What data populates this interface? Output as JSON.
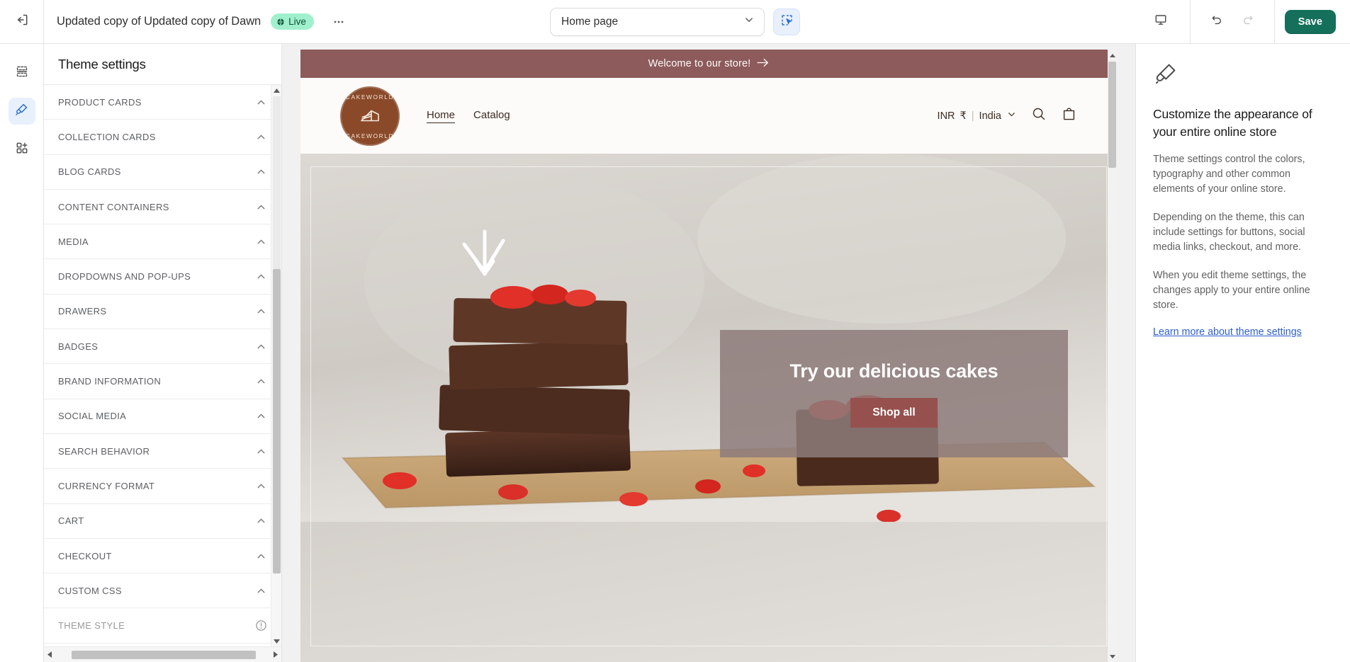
{
  "topbar": {
    "exit_icon": "exit-icon",
    "theme_title": "Updated copy of Updated copy of Dawn",
    "live_badge": "Live",
    "live_icon": "globe-icon",
    "more_icon": "ellipsis-icon",
    "page_selector": {
      "value": "Home page",
      "chevron_icon": "chevron-down-icon"
    },
    "inspect_icon": "inspector-select-icon",
    "device_icon": "desktop-icon",
    "undo_icon": "undo-icon",
    "redo_icon": "redo-icon",
    "save_label": "Save",
    "save_color": "#14705a"
  },
  "rail": {
    "items": [
      {
        "name": "sections-icon",
        "label": "Sections",
        "active": false
      },
      {
        "name": "paintbrush-icon",
        "label": "Theme settings",
        "active": true
      },
      {
        "name": "apps-add-icon",
        "label": "Apps",
        "active": false
      }
    ]
  },
  "settings": {
    "heading": "Theme settings",
    "rows": [
      {
        "label": "PRODUCT CARDS",
        "trailing": "chevron-up-icon",
        "muted": false
      },
      {
        "label": "COLLECTION CARDS",
        "trailing": "chevron-up-icon",
        "muted": false
      },
      {
        "label": "BLOG CARDS",
        "trailing": "chevron-up-icon",
        "muted": false
      },
      {
        "label": "CONTENT CONTAINERS",
        "trailing": "chevron-up-icon",
        "muted": false
      },
      {
        "label": "MEDIA",
        "trailing": "chevron-up-icon",
        "muted": false
      },
      {
        "label": "DROPDOWNS AND POP-UPS",
        "trailing": "chevron-up-icon",
        "muted": false
      },
      {
        "label": "DRAWERS",
        "trailing": "chevron-up-icon",
        "muted": false
      },
      {
        "label": "BADGES",
        "trailing": "chevron-up-icon",
        "muted": false
      },
      {
        "label": "BRAND INFORMATION",
        "trailing": "chevron-up-icon",
        "muted": false
      },
      {
        "label": "SOCIAL MEDIA",
        "trailing": "chevron-up-icon",
        "muted": false
      },
      {
        "label": "SEARCH BEHAVIOR",
        "trailing": "chevron-up-icon",
        "muted": false
      },
      {
        "label": "CURRENCY FORMAT",
        "trailing": "chevron-up-icon",
        "muted": false
      },
      {
        "label": "CART",
        "trailing": "chevron-up-icon",
        "muted": false
      },
      {
        "label": "CHECKOUT",
        "trailing": "chevron-up-icon",
        "muted": false
      },
      {
        "label": "CUSTOM CSS",
        "trailing": "chevron-up-icon",
        "muted": false
      },
      {
        "label": "THEME STYLE",
        "trailing": "info-circle-icon",
        "muted": true
      }
    ]
  },
  "preview": {
    "announcement": {
      "text": "Welcome to our store!",
      "arrow_icon": "arrow-right-icon",
      "background": "#8d5b5b"
    },
    "store_header": {
      "logo": {
        "name": "cakeworld-logo",
        "text_top": "CAKEWORLD",
        "text_bottom": "CAKEWORLD",
        "color": "#8a4a2a"
      },
      "nav": [
        {
          "label": "Home",
          "active": true
        },
        {
          "label": "Catalog",
          "active": false
        }
      ],
      "currency": {
        "code": "INR",
        "symbol": "₹",
        "separator": "|",
        "country": "India",
        "chevron_icon": "chevron-down-icon"
      },
      "search_icon": "search-icon",
      "cart_icon": "shopping-bag-icon"
    },
    "hero": {
      "title": "Try our delicious cakes",
      "button_label": "Shop all",
      "button_color": "#96514f",
      "overlay_color": "#8d7c7a",
      "image_alt": "stack of chocolate brownies with strawberries on burlap"
    },
    "scrollbar": {
      "up_icon": "caret-up-icon",
      "down_icon": "caret-down-icon"
    }
  },
  "info_panel": {
    "icon": "paintbrush-icon",
    "title": "Customize the appearance of your entire online store",
    "paragraphs": [
      "Theme settings control the colors, typography and other common elements of your online store.",
      "Depending on the theme, this can include settings for buttons, social media links, checkout, and more.",
      "When you edit theme settings, the changes apply to your entire online store."
    ],
    "link": "Learn more about theme settings",
    "link_color": "#2c5ecf"
  }
}
